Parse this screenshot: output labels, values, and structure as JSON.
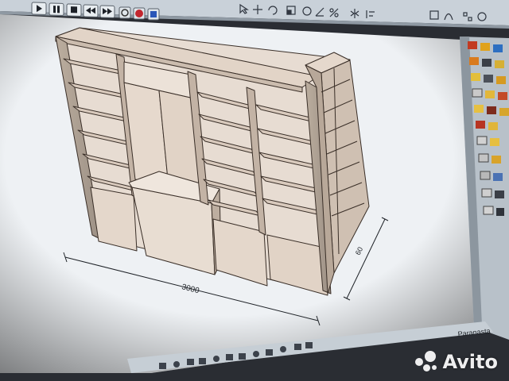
{
  "toolbar": {
    "playback_buttons": [
      "play",
      "pause",
      "stop",
      "rewind",
      "fast-forward"
    ]
  },
  "drawing": {
    "width_dimension": "3000",
    "depth_dimension": "60"
  },
  "status": {
    "text": "Paranasta"
  },
  "watermark": {
    "text": "Avito"
  }
}
